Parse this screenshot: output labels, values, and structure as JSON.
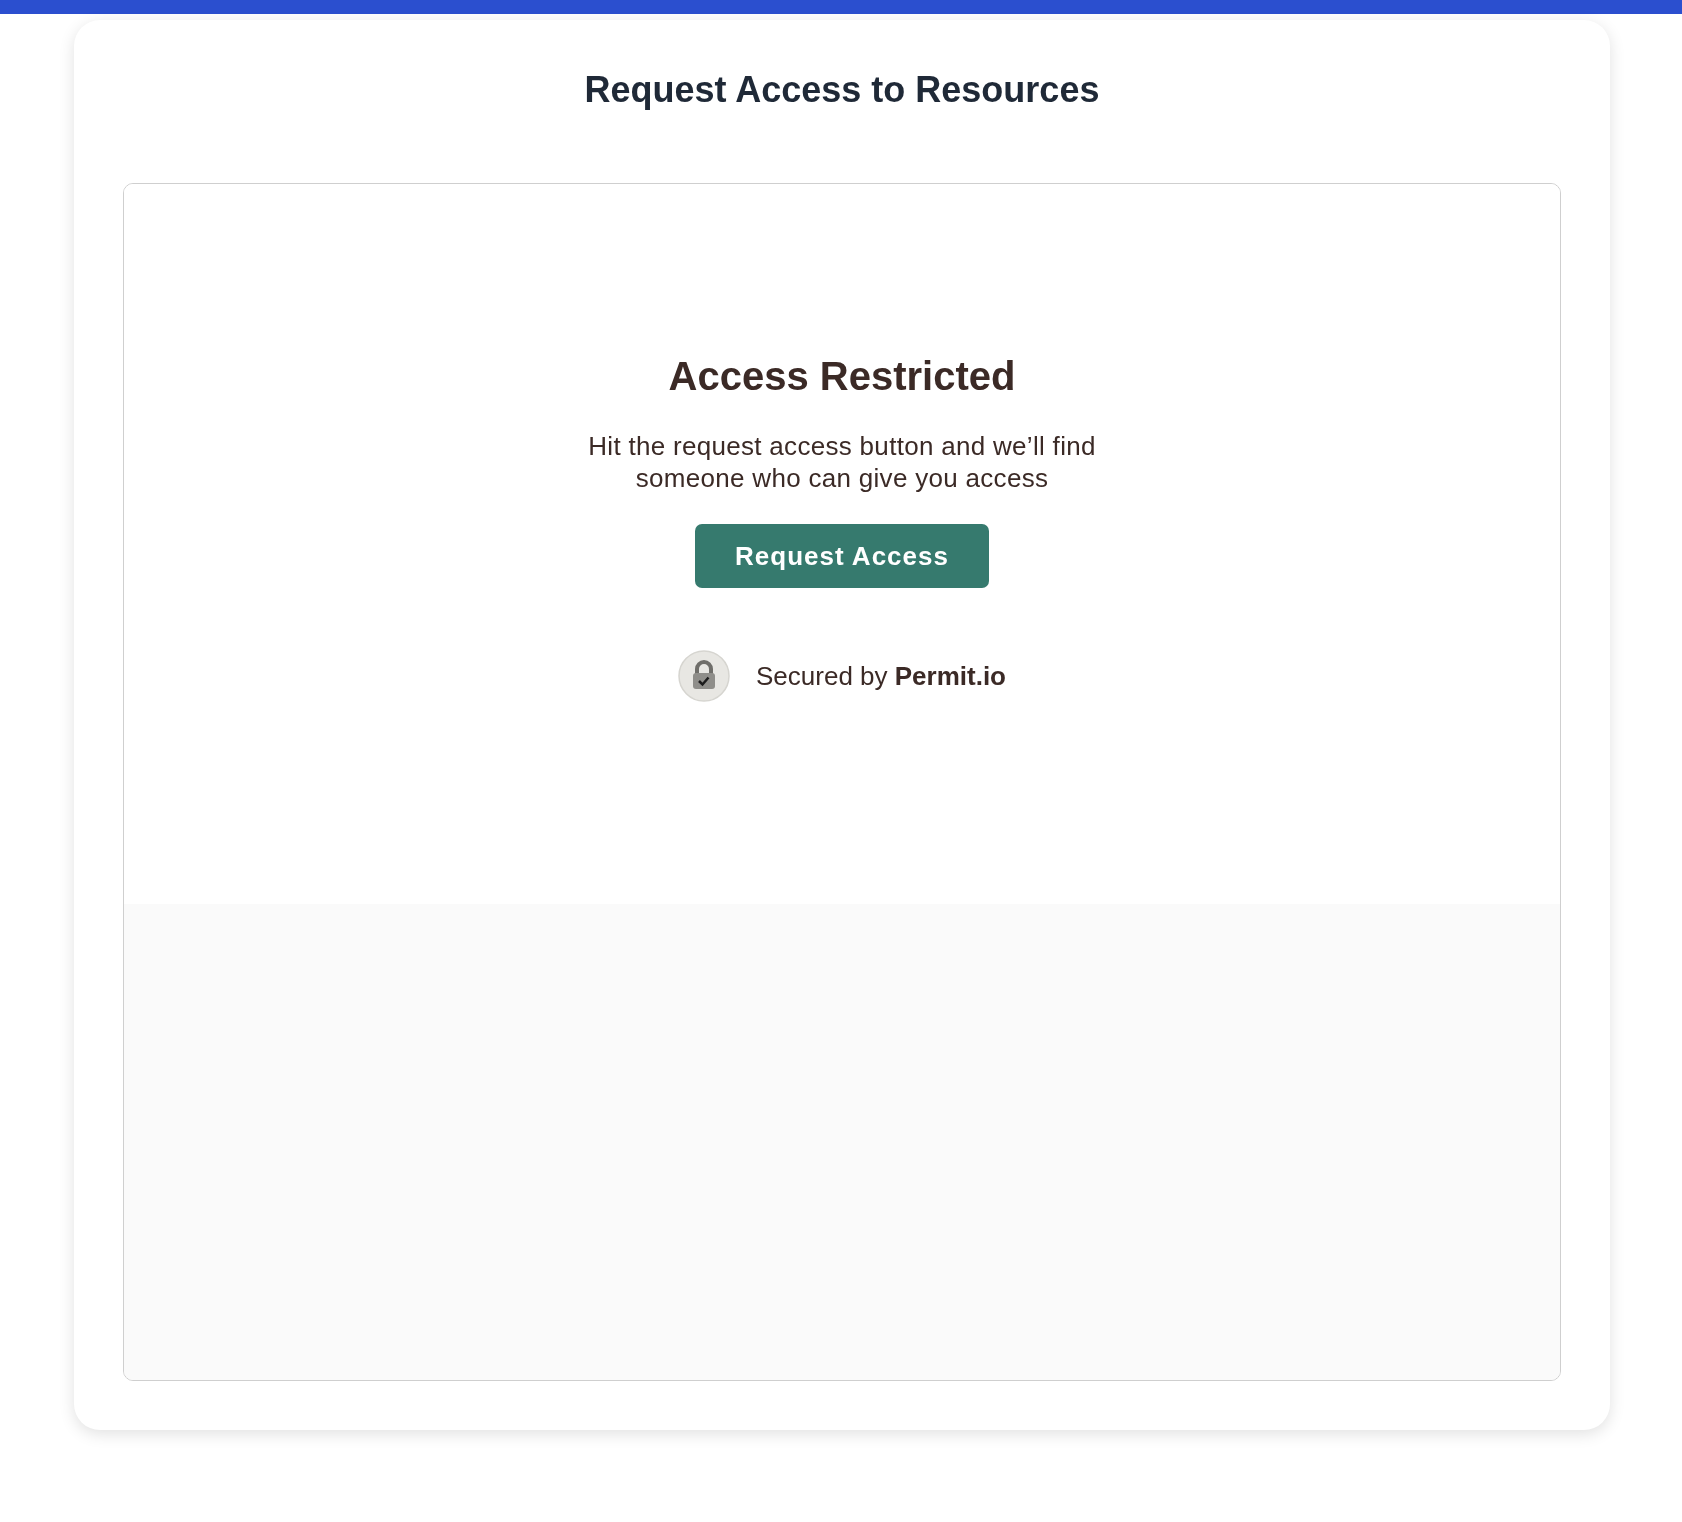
{
  "page": {
    "title": "Request Access to Resources"
  },
  "panel": {
    "heading": "Access Restricted",
    "message": "Hit the request access button and we’ll find someone who can give you access",
    "button": "Request Access",
    "footer": "Secured by **Permit.io**"
  }
}
